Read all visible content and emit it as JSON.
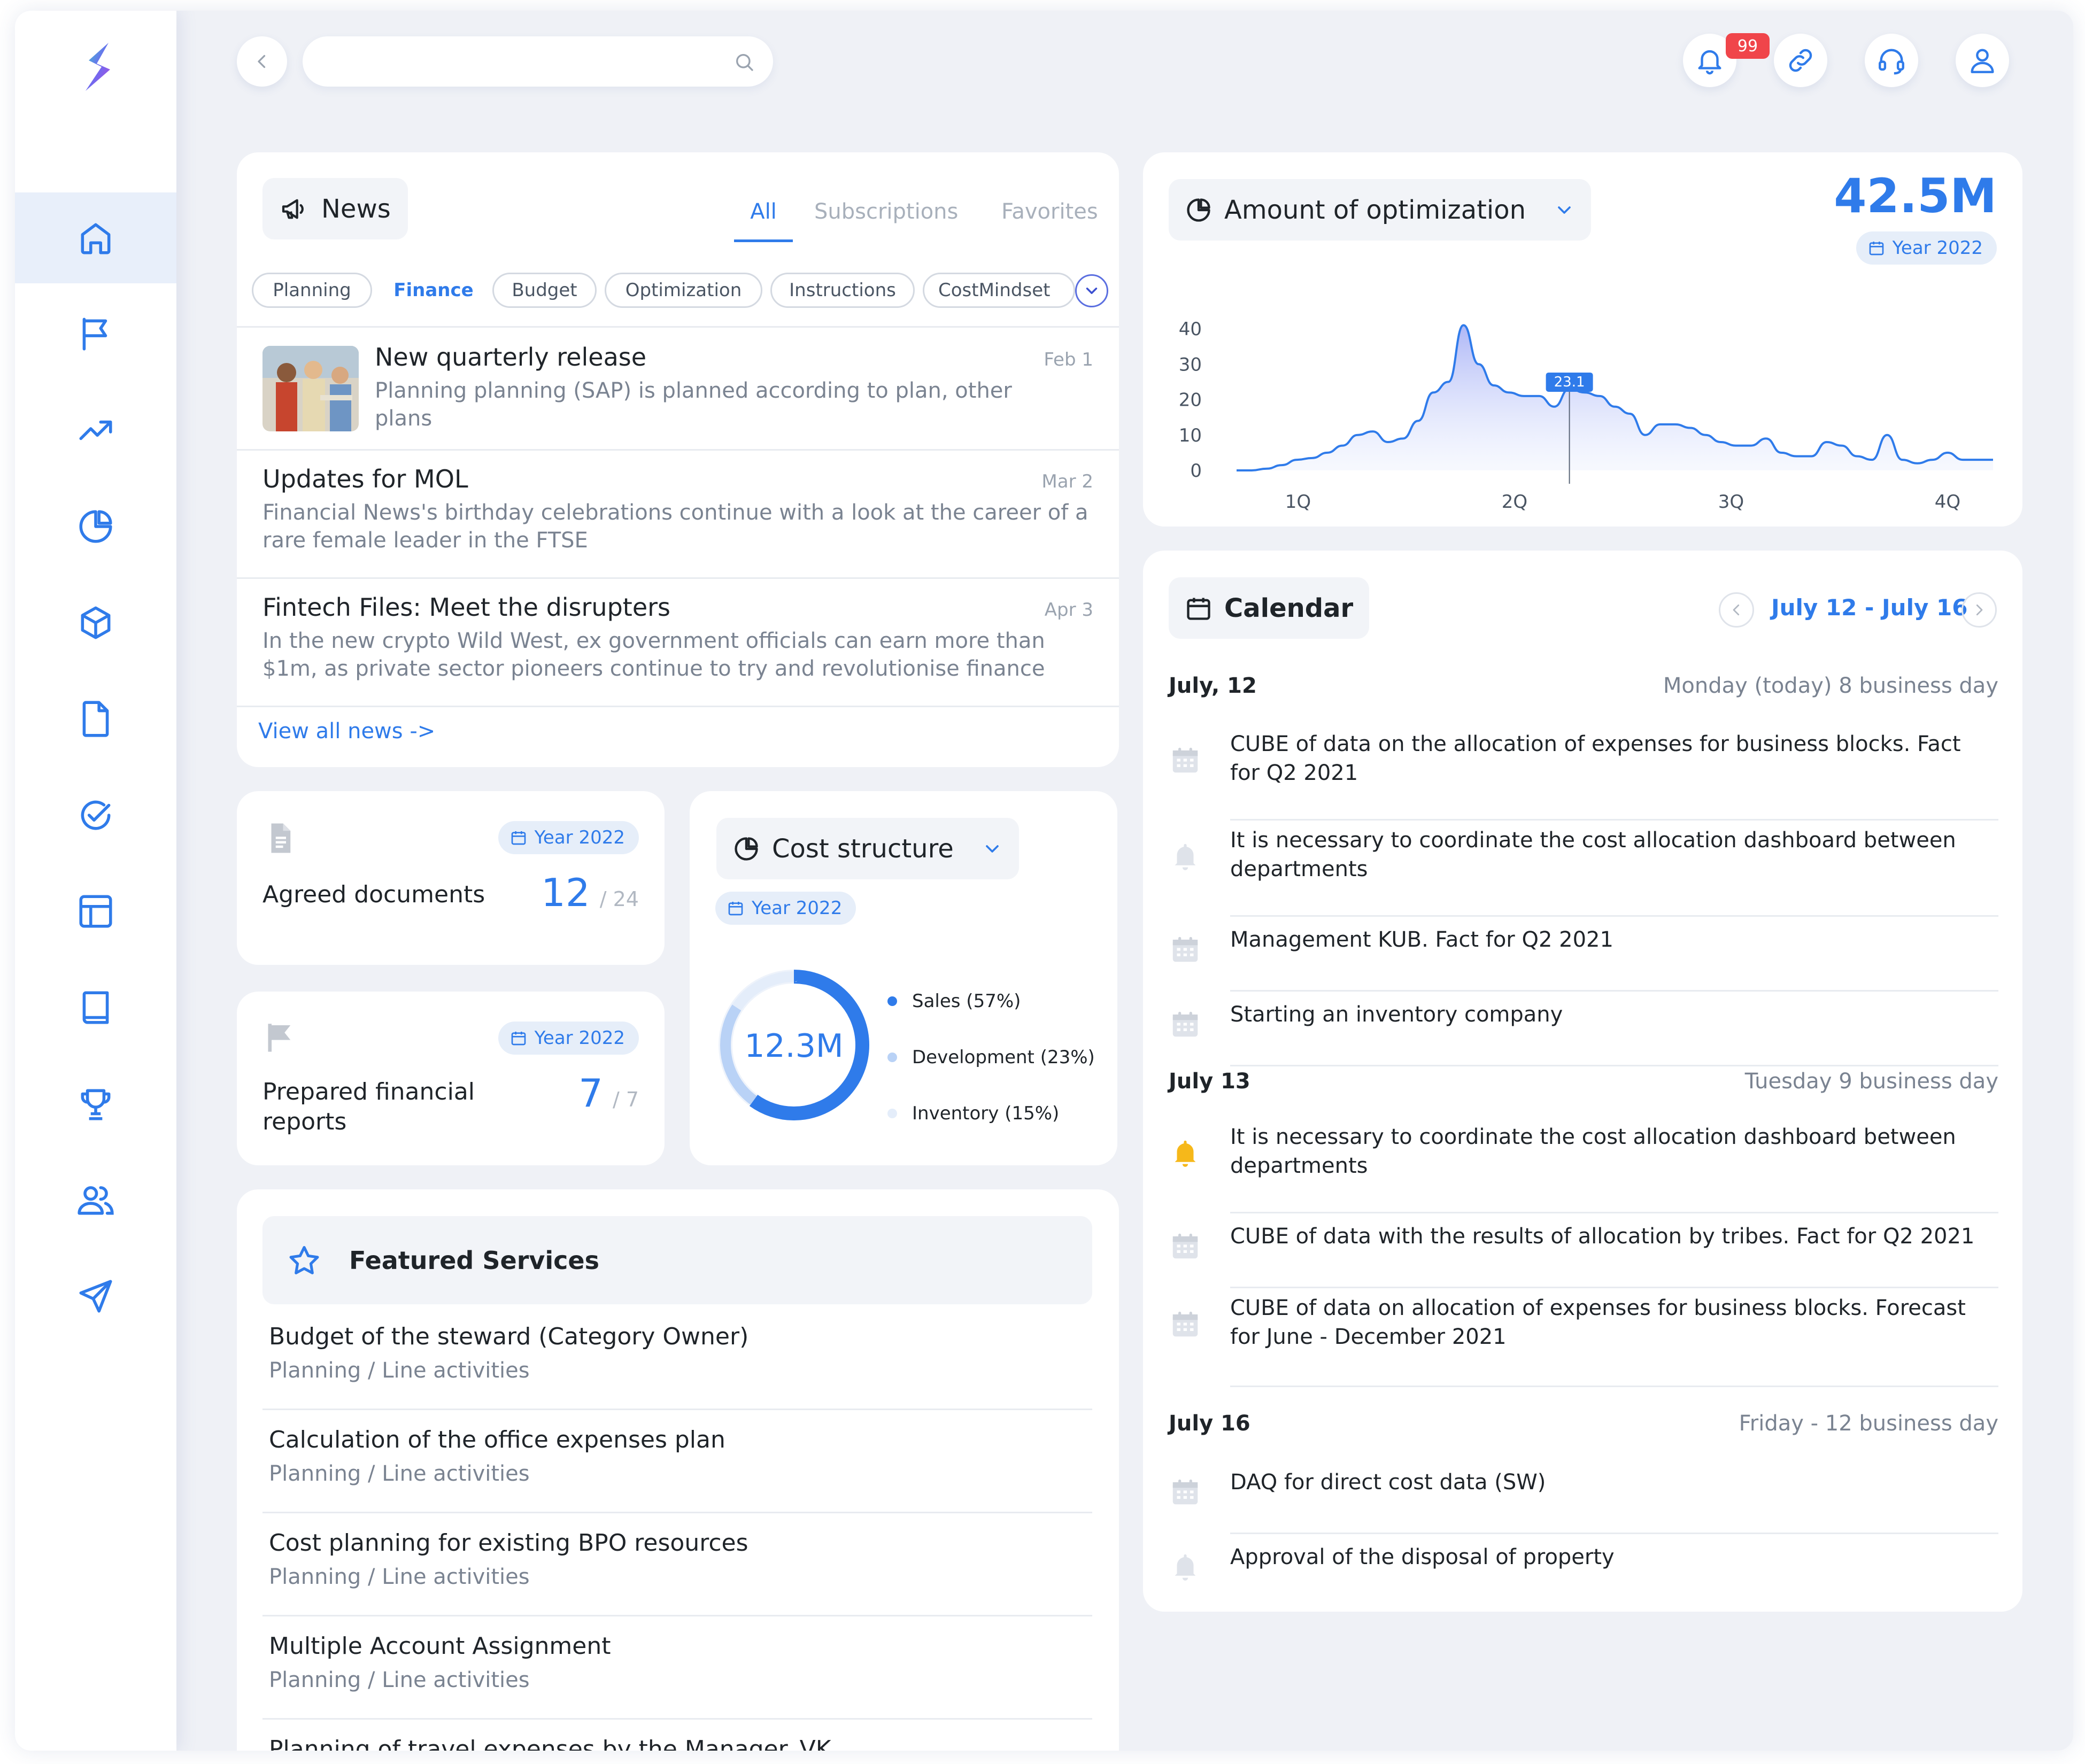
{
  "header": {
    "search": {
      "placeholder": ""
    },
    "notifications_badge": "99"
  },
  "sidebar": {
    "items": [
      {
        "name": "home-icon",
        "active": true
      },
      {
        "name": "flag-icon"
      },
      {
        "name": "trend-icon"
      },
      {
        "name": "pie-chart-icon"
      },
      {
        "name": "box-icon"
      },
      {
        "name": "document-icon"
      },
      {
        "name": "check-circle-icon"
      },
      {
        "name": "layout-icon"
      },
      {
        "name": "book-icon"
      },
      {
        "name": "trophy-icon"
      },
      {
        "name": "users-icon"
      },
      {
        "name": "plane-icon"
      }
    ]
  },
  "news": {
    "title": "News",
    "tabs": [
      {
        "label": "All",
        "active": true
      },
      {
        "label": "Subscriptions"
      },
      {
        "label": "Favorites"
      }
    ],
    "filters": [
      {
        "label": "Planning"
      },
      {
        "label": "Finance",
        "active": true
      },
      {
        "label": "Budget"
      },
      {
        "label": "Optimization"
      },
      {
        "label": "Instructions"
      },
      {
        "label": "CostMindset"
      }
    ],
    "items": [
      {
        "title": "New quarterly release",
        "date": "Feb 1",
        "desc": "Planning planning (SAP) is planned according to plan, other plans",
        "has_image": true
      },
      {
        "title": "Updates for MOL",
        "date": "Mar 2",
        "desc": "Financial News's birthday celebrations continue with a look at the career of a rare female leader in the FTSE"
      },
      {
        "title": "Fintech Files: Meet the disrupters",
        "date": "Apr 3",
        "desc": "In the new crypto Wild West, ex government officials can earn more than $1m, as private sector pioneers continue to try and revolutionise finance"
      }
    ],
    "view_all": "View all news ->"
  },
  "agreed_documents": {
    "year": "Year 2022",
    "label": "Agreed documents",
    "value": "12",
    "total": "/ 24"
  },
  "financial_reports": {
    "year": "Year 2022",
    "label": "Prepared financial reports",
    "value": "7",
    "total": "/ 7"
  },
  "cost_structure": {
    "title": "Cost structure",
    "year": "Year 2022",
    "center_value": "12.3M",
    "legend": [
      {
        "label": "Sales (57%)",
        "color": "#2f7bea"
      },
      {
        "label": "Development (23%)",
        "color": "#b9d2f6"
      },
      {
        "label": "Inventory (15%)",
        "color": "#e4edfa"
      }
    ],
    "chart_data": {
      "type": "pie",
      "labels": [
        "Sales",
        "Development",
        "Inventory"
      ],
      "values": [
        57,
        23,
        15
      ]
    }
  },
  "featured_services": {
    "title": "Featured Services",
    "items": [
      {
        "title": "Budget of the steward (Category Owner)",
        "sub": "Planning / Line activities"
      },
      {
        "title": "Calculation of the office expenses plan",
        "sub": "Planning / Line activities"
      },
      {
        "title": "Cost planning for existing BPO resources",
        "sub": "Planning / Line activities"
      },
      {
        "title": "Multiple Account Assignment",
        "sub": "Planning / Line activities"
      },
      {
        "title": "Planning of travel expenses by the Manager_VK",
        "sub": ""
      }
    ]
  },
  "optimization": {
    "title": "Amount of optimization",
    "total": "42.5M",
    "year": "Year 2022",
    "tooltip": "23.1",
    "chart_data": {
      "type": "area",
      "x_ticks": [
        "1Q",
        "2Q",
        "3Q",
        "4Q"
      ],
      "y_ticks": [
        "40",
        "30",
        "20",
        "10",
        "0"
      ],
      "ylim": [
        0,
        40
      ],
      "series": [
        {
          "values": [
            0,
            0,
            0.5,
            1.5,
            3,
            3.5,
            5,
            7,
            10,
            11,
            8,
            9,
            14,
            22,
            25,
            41,
            30,
            24,
            22,
            21,
            21,
            18,
            23.1,
            22,
            21,
            18,
            16,
            10,
            13,
            13,
            12,
            10,
            8,
            7,
            7,
            9,
            5,
            4,
            4,
            8,
            7,
            4,
            3,
            10,
            3,
            2,
            3,
            5,
            3,
            3,
            3
          ]
        }
      ]
    }
  },
  "calendar": {
    "title": "Calendar",
    "range": "July 12 - July 16",
    "days": [
      {
        "date": "July, 12",
        "info": "Monday (today) 8 business day",
        "events": [
          {
            "text": "CUBE of data on the allocation of expenses for business blocks. Fact for Q2 2021",
            "icon": "calendar-icon"
          },
          {
            "text": "It is necessary to coordinate the cost allocation dashboard between departments",
            "icon": "bell-icon"
          },
          {
            "text": "Management KUB. Fact for Q2 2021",
            "icon": "calendar-icon"
          },
          {
            "text": "Starting an inventory company",
            "icon": "calendar-icon"
          }
        ]
      },
      {
        "date": "July 13",
        "info": "Tuesday 9 business day",
        "events": [
          {
            "text": "It is necessary to coordinate the cost allocation dashboard between departments",
            "icon": "bell-active-icon"
          },
          {
            "text": "CUBE of data with the results of allocation by tribes. Fact for Q2 2021",
            "icon": "calendar-icon"
          },
          {
            "text": "CUBE of data on allocation of expenses for business blocks. Forecast for June - December 2021",
            "icon": "calendar-icon"
          }
        ]
      },
      {
        "date": "July 16",
        "info": "Friday - 12 business day",
        "events": [
          {
            "text": "DAQ for direct cost data (SW)",
            "icon": "calendar-icon"
          },
          {
            "text": "Approval of the disposal of property",
            "icon": "bell-icon"
          }
        ]
      }
    ]
  },
  "colors": {
    "accent": "#2f7bea",
    "muted": "#7a8391",
    "bg": "#eff1f6",
    "badge": "#f0454a",
    "warning": "#f6b81a"
  }
}
